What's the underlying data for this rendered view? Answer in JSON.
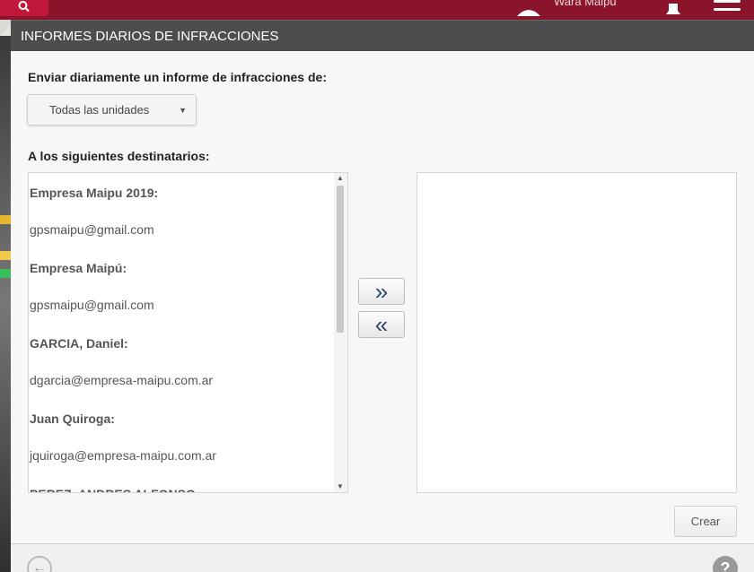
{
  "topbar": {
    "user_name": "Wara Maipu",
    "icons": {
      "search": "search-icon",
      "user": "user-icon",
      "notifications": "bell-icon",
      "menu": "hamburger-menu-icon"
    },
    "colors": {
      "bar": "#8a1429",
      "search_button": "#c0173a"
    }
  },
  "dialog": {
    "title": "INFORMES DIARIOS DE INFRACCIONES",
    "report_label": "Enviar diariamente un informe de infracciones de:",
    "unit_select": {
      "selected": "Todas las unidades"
    },
    "recipients_label": "A los siguientes destinatarios:",
    "available_recipients": [
      {
        "name": "Empresa Maipu 2019:",
        "email": "gpsmaipu@gmail.com"
      },
      {
        "name": "Empresa Maipú:",
        "email": "gpsmaipu@gmail.com"
      },
      {
        "name": "GARCIA, Daniel:",
        "email": "dgarcia@empresa-maipu.com.ar"
      },
      {
        "name": "Juan Quiroga:",
        "email": "jquiroga@empresa-maipu.com.ar"
      },
      {
        "name": "PEREZ, ANDRES ALFONSO",
        "email": ""
      }
    ],
    "add_button_label": "»",
    "remove_button_label": "«",
    "create_button_label": "Crear",
    "footer": {
      "back_icon": "back-arrow-icon",
      "help_icon": "help-icon",
      "help_glyph": "?"
    }
  }
}
